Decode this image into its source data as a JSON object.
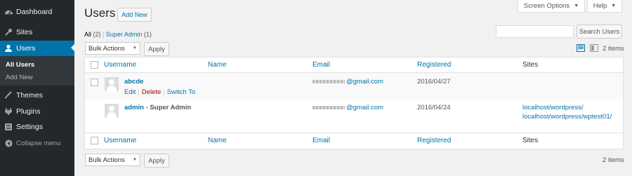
{
  "sidebar": {
    "items": [
      {
        "label": "Dashboard",
        "icon": "dashboard-icon"
      },
      {
        "label": "Sites",
        "icon": "wrench-icon"
      },
      {
        "label": "Users",
        "icon": "user-icon"
      },
      {
        "label": "Themes",
        "icon": "brush-icon"
      },
      {
        "label": "Plugins",
        "icon": "plug-icon"
      },
      {
        "label": "Settings",
        "icon": "settings-icon"
      }
    ],
    "submenu": [
      "All Users",
      "Add New"
    ],
    "collapse_label": "Collapse menu"
  },
  "header": {
    "title": "Users",
    "add_new": "Add New",
    "screen_options": "Screen Options",
    "help": "Help"
  },
  "filters": {
    "all_label": "All",
    "all_count": "(2)",
    "separator": "|",
    "super_admin_label": "Super Admin",
    "super_admin_count": "(1)"
  },
  "search": {
    "placeholder": "",
    "button": "Search Users"
  },
  "bulk": {
    "select": "Bulk Actions",
    "apply": "Apply"
  },
  "items_count": "2 items",
  "columns": [
    "Username",
    "Name",
    "Email",
    "Registered",
    "Sites"
  ],
  "rows": [
    {
      "username": "abcde",
      "role": "",
      "actions": [
        "Edit",
        "Delete",
        "Switch To"
      ],
      "email": "@gmail.com",
      "registered": "2016/04/27",
      "sites": []
    },
    {
      "username": "admin",
      "role": " - Super Admin",
      "actions": [],
      "email": "@gmail.com",
      "registered": "2016/04/24",
      "sites": [
        "localhost/wordpress/",
        "localhost/wordpress/wptest01/"
      ]
    }
  ],
  "colors": {
    "sidebar_bg": "#23282d",
    "accent": "#0073aa",
    "delete": "#aa0000"
  }
}
